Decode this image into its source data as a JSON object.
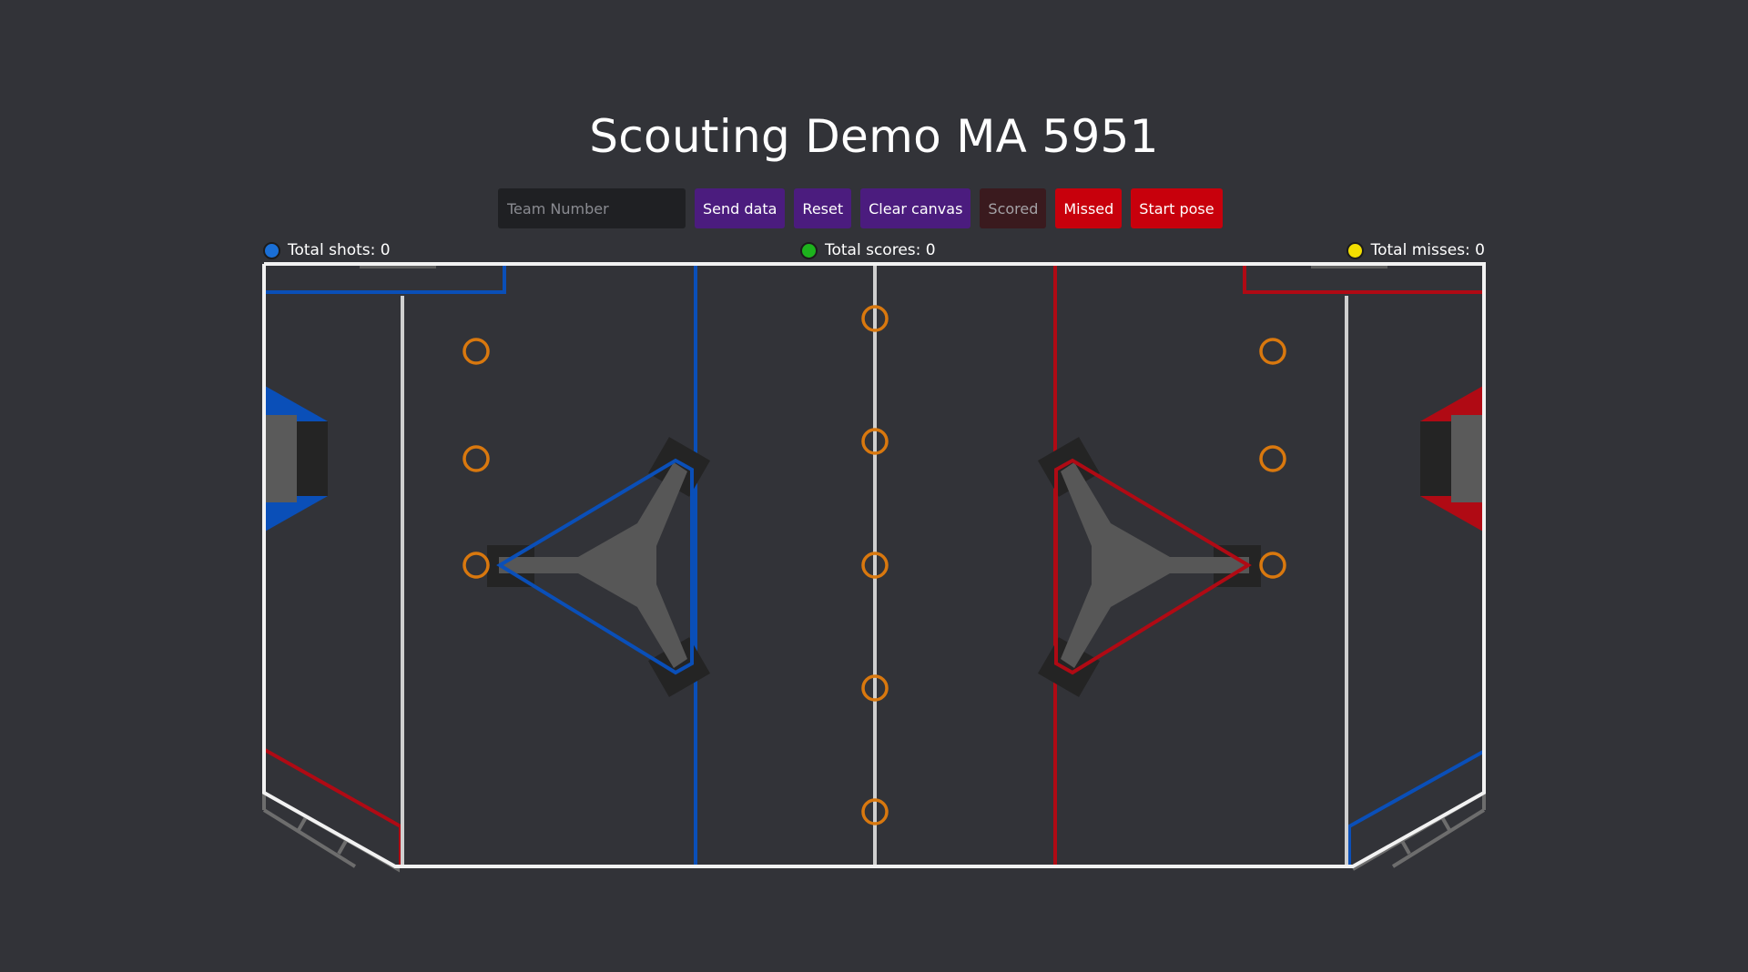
{
  "header": {
    "title": "Scouting Demo MA 5951"
  },
  "toolbar": {
    "team_placeholder": "Team Number",
    "team_value": "",
    "send_label": "Send data",
    "reset_label": "Reset",
    "clear_label": "Clear canvas",
    "scored_label": "Scored",
    "missed_label": "Missed",
    "start_pose_label": "Start pose"
  },
  "stats": {
    "shots_label": "Total shots: 0",
    "scores_label": "Total scores: 0",
    "misses_label": "Total misses: 0",
    "shots_color": "#1a6fd6",
    "scores_color": "#1db31d",
    "misses_color": "#f2de00"
  },
  "colors": {
    "background": "#323338",
    "purple_button": "#4b1c7e",
    "red_button": "#c8000c",
    "blue_alliance": "#0a4fb8",
    "red_alliance": "#b00a14",
    "field_line": "#e0e0e0",
    "game_piece_ring": "#d9780e"
  },
  "field": {
    "game_piece_count": 11
  }
}
